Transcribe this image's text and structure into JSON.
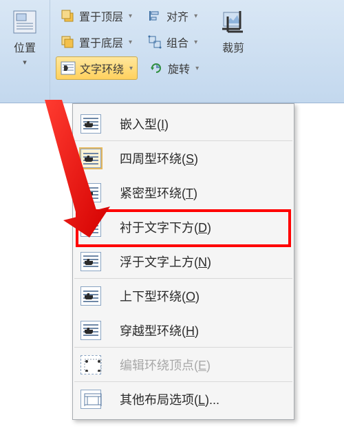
{
  "ribbon": {
    "position": {
      "label": "位置"
    },
    "bringFront": {
      "label": "置于顶层"
    },
    "sendBack": {
      "label": "置于底层"
    },
    "textWrap": {
      "label": "文字环绕"
    },
    "align": {
      "label": "对齐"
    },
    "group": {
      "label": "组合"
    },
    "rotate": {
      "label": "旋转"
    },
    "crop": {
      "label": "裁剪"
    }
  },
  "menu": {
    "items": [
      {
        "label": "嵌入型",
        "accel": "I",
        "sepAfter": true
      },
      {
        "label": "四周型环绕",
        "accel": "S"
      },
      {
        "label": "紧密型环绕",
        "accel": "T"
      },
      {
        "label": "衬于文字下方",
        "accel": "D",
        "highlighted": true
      },
      {
        "label": "浮于文字上方",
        "accel": "N",
        "sepAfter": true
      },
      {
        "label": "上下型环绕",
        "accel": "O"
      },
      {
        "label": "穿越型环绕",
        "accel": "H",
        "sepAfter": true
      },
      {
        "label": "编辑环绕顶点",
        "accel": "E",
        "disabled": true,
        "sepAfter": true
      },
      {
        "label": "其他布局选项",
        "accel": "L",
        "trailing": "..."
      }
    ]
  }
}
